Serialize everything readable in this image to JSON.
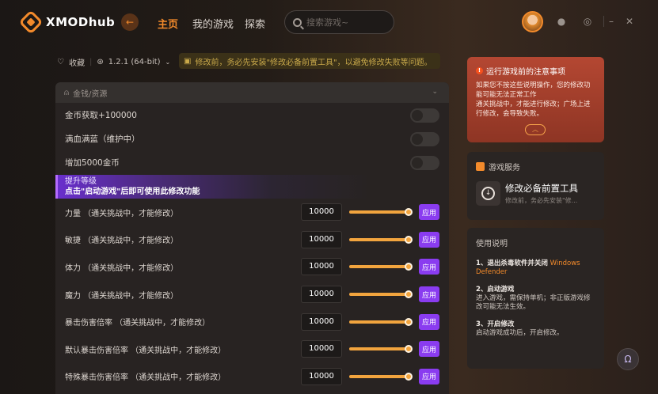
{
  "app": {
    "name": "XMODhub"
  },
  "nav": {
    "back_icon": "back-arrow-icon",
    "items": [
      "主页",
      "我的游戏",
      "探索"
    ],
    "active": "主页"
  },
  "search": {
    "placeholder": "搜索游戏~"
  },
  "infobar": {
    "favorite_label": "收藏",
    "version": "1.2.1 (64-bit)",
    "notice": "修改前，务必先安装\"修改必备前置工具\"，以避免修改失败等问题。"
  },
  "section": {
    "title": "金钱/资源"
  },
  "toggles": [
    {
      "label": "金币获取+100000",
      "on": false
    },
    {
      "label": "满血满蓝（维护中）",
      "on": false
    },
    {
      "label": "增加5000金币",
      "on": false
    }
  ],
  "banner": {
    "title": "提升等级",
    "subtitle": "点击\"启动游戏\"后即可使用此修改功能"
  },
  "stats": [
    {
      "label": "力量 （通关挑战中，才能修改）",
      "value": "10000",
      "apply": "应用"
    },
    {
      "label": "敏捷 （通关挑战中，才能修改）",
      "value": "10000",
      "apply": "应用"
    },
    {
      "label": "体力 （通关挑战中，才能修改）",
      "value": "10000",
      "apply": "应用"
    },
    {
      "label": "魔力 （通关挑战中，才能修改）",
      "value": "10000",
      "apply": "应用"
    },
    {
      "label": "暴击伤害倍率 （通关挑战中，才能修改）",
      "value": "10000",
      "apply": "应用"
    },
    {
      "label": "默认暴击伤害倍率 （通关挑战中，才能修改）",
      "value": "10000",
      "apply": "应用"
    },
    {
      "label": "特殊暴击伤害倍率 （通关挑战中，才能修改）",
      "value": "10000",
      "apply": "应用"
    }
  ],
  "warning": {
    "title": "运行游戏前的注意事项",
    "lines": [
      "如果您不按这些说明操作，您的修改功能可能无法正常工作",
      "通关挑战中，才能进行修改；广场上进行修改，会导致失败。"
    ]
  },
  "service": {
    "title": "游戏服务",
    "tool_name": "修改必备前置工具",
    "tool_desc": "修改前，务必先安装\"修..."
  },
  "usage": {
    "title": "使用说明",
    "step1_title": "1、退出杀毒软件并关闭",
    "step1_highlight": "Windows Defender",
    "step2_title": "2、启动游戏",
    "step2_text": "进入游戏，需保持单机；非正版游戏修改可能无法生效。",
    "step3_title": "3、开启修改",
    "step3_text": "启动游戏成功后，开启修改。"
  },
  "colors": {
    "accent": "#f28a2b",
    "purple": "#8a3cf0",
    "warning_bg": "#b44732"
  }
}
